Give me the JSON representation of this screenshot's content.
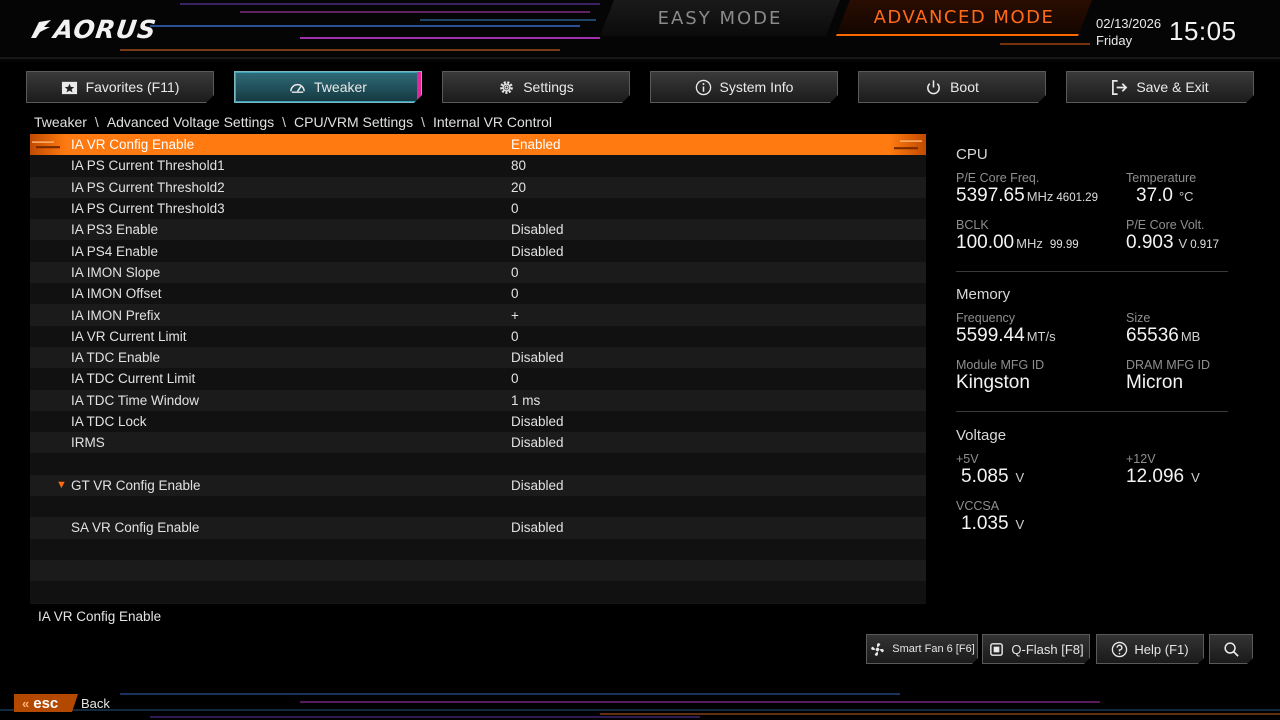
{
  "header": {
    "brand": "AORUS",
    "easy_mode": "EASY MODE",
    "advanced_mode": "ADVANCED MODE",
    "date": "02/13/2026",
    "day": "Friday",
    "time": "15:05",
    "accent": "#ff6a10"
  },
  "tabs": [
    {
      "label": "Favorites (F11)",
      "icon": "star-folder-icon"
    },
    {
      "label": "Tweaker",
      "icon": "speedometer-icon",
      "active": true
    },
    {
      "label": "Settings",
      "icon": "gear-icon"
    },
    {
      "label": "System Info",
      "icon": "info-icon"
    },
    {
      "label": "Boot",
      "icon": "power-icon"
    },
    {
      "label": "Save & Exit",
      "icon": "exit-icon"
    }
  ],
  "breadcrumb": [
    "Tweaker",
    "Advanced Voltage Settings",
    "CPU/VRM Settings",
    "Internal VR Control"
  ],
  "breadcrumb_sep": "\\",
  "settings": [
    {
      "name": "IA VR Config Enable",
      "value": "Enabled"
    },
    {
      "name": "IA PS Current Threshold1",
      "value": "80"
    },
    {
      "name": "IA PS Current Threshold2",
      "value": "20"
    },
    {
      "name": "IA PS Current Threshold3",
      "value": "0"
    },
    {
      "name": "IA PS3 Enable",
      "value": "Disabled"
    },
    {
      "name": "IA PS4 Enable",
      "value": "Disabled"
    },
    {
      "name": "IA IMON Slope",
      "value": "0"
    },
    {
      "name": "IA IMON Offset",
      "value": "0"
    },
    {
      "name": "IA IMON Prefix",
      "value": "+"
    },
    {
      "name": "IA VR Current Limit",
      "value": "0"
    },
    {
      "name": "IA TDC Enable",
      "value": "Disabled"
    },
    {
      "name": "IA TDC Current Limit",
      "value": "0"
    },
    {
      "name": "IA TDC Time Window",
      "value": "1 ms"
    },
    {
      "name": "IA TDC Lock",
      "value": "Disabled"
    },
    {
      "name": "IRMS",
      "value": "Disabled"
    },
    {
      "name": "GT VR Config Enable",
      "value": "Disabled"
    },
    {
      "name": "SA VR Config Enable",
      "value": "Disabled"
    }
  ],
  "help_text": "IA VR Config Enable",
  "cpu": {
    "title": "CPU",
    "freq_label": "P/E Core Freq.",
    "freq_value": "5397.65",
    "freq_unit": "MHz",
    "freq_sub": "4601.29",
    "temp_label": "Temperature",
    "temp_value": "37.0",
    "temp_unit": "°C",
    "bclk_label": "BCLK",
    "bclk_value": "100.00",
    "bclk_unit": "MHz",
    "bclk_sub": "99.99",
    "volt_label": "P/E Core Volt.",
    "volt_value": "0.903",
    "volt_unit": "V",
    "volt_sub": "0.917"
  },
  "memory": {
    "title": "Memory",
    "freq_label": "Frequency",
    "freq_value": "5599.44",
    "freq_unit": "MT/s",
    "size_label": "Size",
    "size_value": "65536",
    "size_unit": "MB",
    "module_label": "Module MFG ID",
    "module_value": "Kingston",
    "dram_label": "DRAM MFG ID",
    "dram_value": "Micron"
  },
  "voltage": {
    "title": "Voltage",
    "v5_label": "+5V",
    "v5_value": "5.085",
    "v12_label": "+12V",
    "v12_value": "12.096",
    "vccsa_label": "VCCSA",
    "vccsa_value": "1.035",
    "unit": "V"
  },
  "bottom": {
    "smartfan": "Smart Fan 6 [F6]",
    "qflash": "Q-Flash [F8]",
    "help": "Help (F1)",
    "esc": "esc",
    "back": "Back"
  }
}
